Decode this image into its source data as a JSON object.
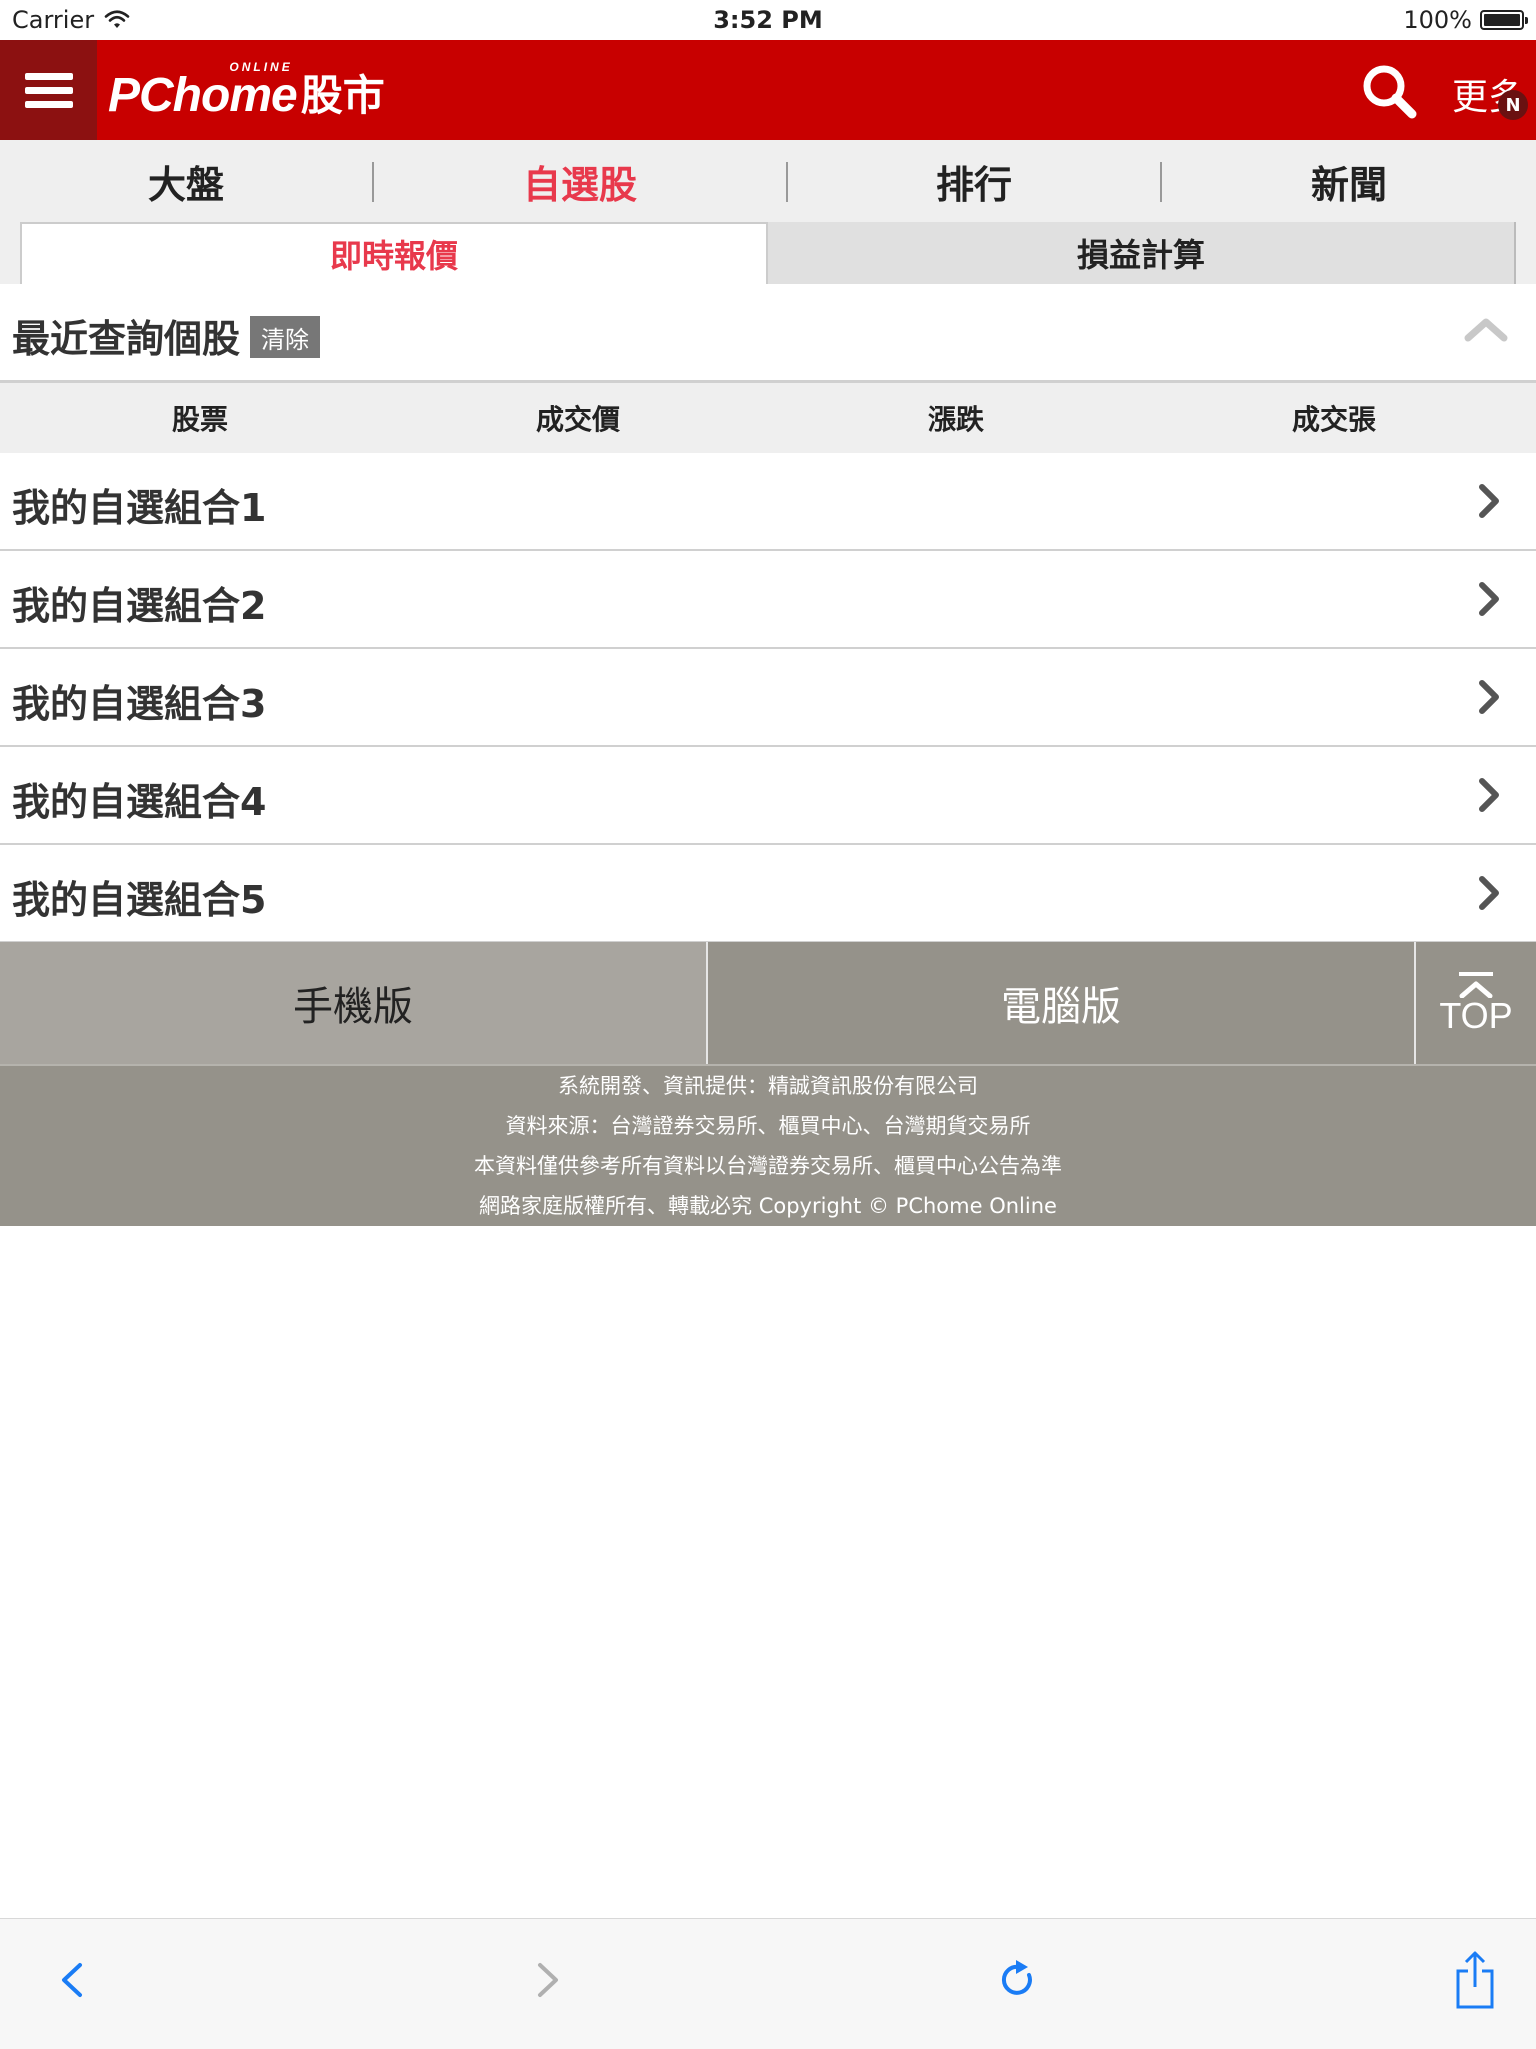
{
  "status_bar": {
    "carrier": "Carrier",
    "time": "3:52 PM",
    "battery": "100%"
  },
  "header": {
    "logo_main": "PChome",
    "logo_online": "ONLINE",
    "logo_sub": "股市",
    "more_label": "更多",
    "badge": "N"
  },
  "main_tabs": [
    {
      "label": "大盤",
      "active": false
    },
    {
      "label": "自選股",
      "active": true
    },
    {
      "label": "排行",
      "active": false
    },
    {
      "label": "新聞",
      "active": false
    }
  ],
  "sub_tabs": [
    {
      "label": "即時報價",
      "active": true
    },
    {
      "label": "損益計算",
      "active": false
    }
  ],
  "recent": {
    "title": "最近查詢個股",
    "clear_label": "清除"
  },
  "columns": [
    "股票",
    "成交價",
    "漲跌",
    "成交張"
  ],
  "groups": [
    "我的自選組合1",
    "我的自選組合2",
    "我的自選組合3",
    "我的自選組合4",
    "我的自選組合5"
  ],
  "footer_buttons": {
    "mobile": "手機版",
    "desktop": "電腦版",
    "top": "TOP"
  },
  "footer_info": [
    "系統開發、資訊提供：精誠資訊股份有限公司",
    "資料來源：台灣證券交易所、櫃買中心、台灣期貨交易所",
    "本資料僅供參考所有資料以台灣證券交易所、櫃買中心公告為準",
    "網路家庭版權所有、轉載必究 Copyright © PChome Online"
  ],
  "colors": {
    "brand_red": "#c80000",
    "active_tab": "#e8394c",
    "ios_blue": "#1a7cf5"
  },
  "icons": {
    "menu": "hamburger-icon",
    "search": "search-icon",
    "collapse": "chevron-up-icon",
    "group_arrow": "chevron-right-icon",
    "back": "back-icon",
    "forward": "forward-icon",
    "reload": "reload-icon",
    "share": "share-icon"
  }
}
